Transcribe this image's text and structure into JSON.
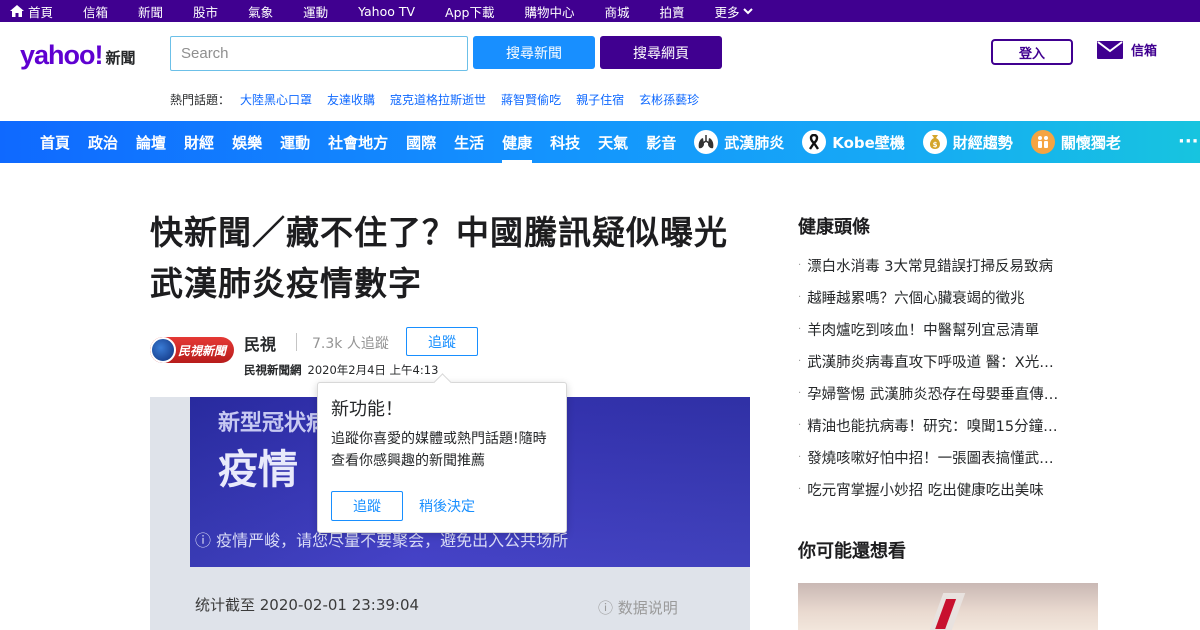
{
  "topbar": {
    "items": [
      "首頁",
      "信箱",
      "新聞",
      "股市",
      "氣象",
      "運動",
      "Yahoo TV",
      "App下載",
      "購物中心",
      "商城",
      "拍賣"
    ],
    "more": "更多"
  },
  "header": {
    "logo": "yahoo!",
    "logo_sub": "新聞",
    "search_placeholder": "Search",
    "search_news": "搜尋新聞",
    "search_web": "搜尋網頁",
    "login": "登入",
    "mail": "信箱"
  },
  "trending": {
    "label": "熱門話題：",
    "topics": [
      "大陸黑心口罩",
      "友達收購",
      "寇克道格拉斯逝世",
      "蔣智賢偷吃",
      "親子住宿",
      "玄彬孫藝珍"
    ]
  },
  "nav": {
    "items": [
      "首頁",
      "政治",
      "論壇",
      "財經",
      "娛樂",
      "運動",
      "社會地方",
      "國際",
      "生活",
      "健康",
      "科技",
      "天氣",
      "影音"
    ],
    "active": "健康",
    "special": [
      {
        "label": "武漢肺炎",
        "icon": "lungs-icon"
      },
      {
        "label": "Kobe壁機",
        "icon": "ribbon-icon"
      },
      {
        "label": "財經趨勢",
        "icon": "money-bag-icon"
      },
      {
        "label": "關懷獨老",
        "icon": "elderly-icon"
      }
    ],
    "more": "···"
  },
  "article": {
    "title": "快新聞／藏不住了？中國騰訊疑似曝光武漢肺炎疫情數字",
    "publisher_logo_text": "民視新聞",
    "publisher": "民視",
    "followers": "7.3k 人追蹤",
    "follow": "追蹤",
    "source": "民視新聞網",
    "date": "2020年2月4日 上午4:13",
    "image_text": {
      "line1": "新型冠状病",
      "line2": "疫情",
      "line3": "ⓘ 疫情严峻，请您尽量不要聚会，避免出入公共场所",
      "line4": "统计截至 2020-02-01 23:39:04",
      "line5": "ⓘ 数据说明"
    }
  },
  "popover": {
    "title": "新功能！",
    "body": "追蹤你喜愛的媒體或熱門話題!隨時查看你感興趣的新聞推薦",
    "follow": "追蹤",
    "later": "稍後決定"
  },
  "sidebar": {
    "heading": "健康頭條",
    "items": [
      "漂白水消毒 3大常見錯誤打掃反易致病",
      "越睡越累嗎？六個心臟衰竭的徵兆",
      "羊肉爐吃到咳血！中醫幫列宜忌清單",
      "武漢肺炎病毒直攻下呼吸道 醫：X光…",
      "孕婦警惕 武漢肺炎恐存在母嬰垂直傳…",
      "精油也能抗病毒！研究：嗅聞15分鐘…",
      "發燒咳嗽好怕中招！一張圖表搞懂武…",
      "吃元宵掌握小妙招 吃出健康吃出美味"
    ],
    "heading2": "你可能還想看"
  },
  "colors": {
    "purple": "#400090",
    "blue": "#188fff",
    "brand": "#5f01d1"
  }
}
